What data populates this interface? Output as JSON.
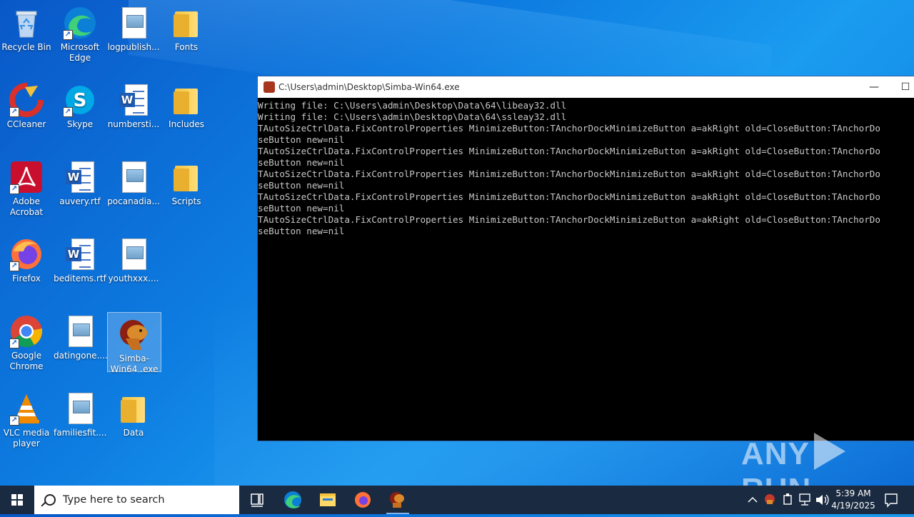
{
  "desktop": {
    "icons": [
      {
        "label": "Recycle Bin"
      },
      {
        "label": "Microsoft Edge"
      },
      {
        "label": "logpublish..."
      },
      {
        "label": "Fonts"
      },
      {
        "label": "CCleaner"
      },
      {
        "label": "Skype"
      },
      {
        "label": "numbersti..."
      },
      {
        "label": "Includes"
      },
      {
        "label": "Adobe Acrobat"
      },
      {
        "label": "auvery.rtf"
      },
      {
        "label": "pocanadia..."
      },
      {
        "label": "Scripts"
      },
      {
        "label": "Firefox"
      },
      {
        "label": "beditems.rtf"
      },
      {
        "label": "youthxxx...."
      },
      {
        "label": "Google Chrome"
      },
      {
        "label": "datingone...."
      },
      {
        "label": "Simba-Win64 .exe"
      },
      {
        "label": "VLC media player"
      },
      {
        "label": "familiesfit...."
      },
      {
        "label": "Data"
      }
    ]
  },
  "terminal": {
    "title": "C:\\Users\\admin\\Desktop\\Simba-Win64.exe",
    "lines": [
      "Writing file: C:\\Users\\admin\\Desktop\\Data\\64\\libeay32.dll",
      "Writing file: C:\\Users\\admin\\Desktop\\Data\\64\\ssleay32.dll",
      "TAutoSizeCtrlData.FixControlProperties MinimizeButton:TAnchorDockMinimizeButton a=akRight old=CloseButton:TAnchorDo",
      "seButton new=nil",
      "TAutoSizeCtrlData.FixControlProperties MinimizeButton:TAnchorDockMinimizeButton a=akRight old=CloseButton:TAnchorDo",
      "seButton new=nil",
      "TAutoSizeCtrlData.FixControlProperties MinimizeButton:TAnchorDockMinimizeButton a=akRight old=CloseButton:TAnchorDo",
      "seButton new=nil",
      "TAutoSizeCtrlData.FixControlProperties MinimizeButton:TAnchorDockMinimizeButton a=akRight old=CloseButton:TAnchorDo",
      "seButton new=nil",
      "TAutoSizeCtrlData.FixControlProperties MinimizeButton:TAnchorDockMinimizeButton a=akRight old=CloseButton:TAnchorDo",
      "seButton new=nil"
    ],
    "minimize_glyph": "—",
    "maximize_glyph": "☐"
  },
  "watermark": {
    "left": "ANY",
    "right": "RUN"
  },
  "taskbar": {
    "search_placeholder": "Type here to search",
    "clock_time": "5:39 AM",
    "clock_date": "4/19/2025",
    "pinned": [
      "task-view-icon",
      "edge-icon",
      "file-explorer-icon",
      "firefox-icon",
      "simba-icon"
    ],
    "tray": [
      "chevron-up-icon",
      "simba-tray-icon",
      "usb-icon",
      "network-icon",
      "volume-icon"
    ]
  },
  "colors": {
    "accent": "#1a9cf0",
    "taskbar": "#1a2a40"
  }
}
